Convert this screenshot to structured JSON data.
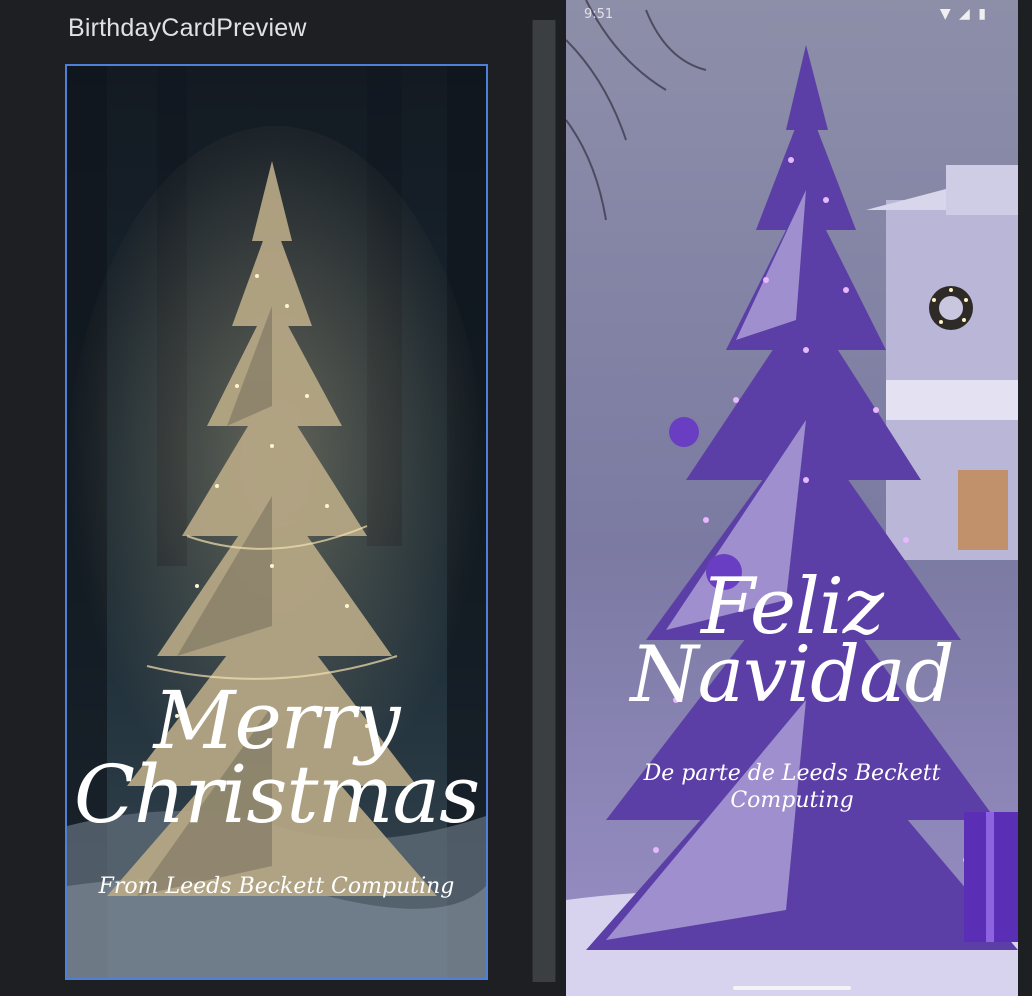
{
  "preview": {
    "title": "BirthdayCardPreview"
  },
  "card_left": {
    "greeting_line1": "Merry",
    "greeting_line2": "Christmas",
    "from_text": "From Leeds Beckett Computing"
  },
  "card_right": {
    "greeting_line1": "Feliz",
    "greeting_line2": "Navidad",
    "from_text": "De parte de Leeds Beckett Computing"
  },
  "status_bar": {
    "time": "9:51",
    "icons": [
      "wifi-icon",
      "signal-icon",
      "battery-icon"
    ]
  },
  "colors": {
    "selection_border": "#4e7fd9",
    "ide_background": "#1e1f22",
    "tree_left": "#c9b89a",
    "tree_right": "#7a4fd0"
  }
}
